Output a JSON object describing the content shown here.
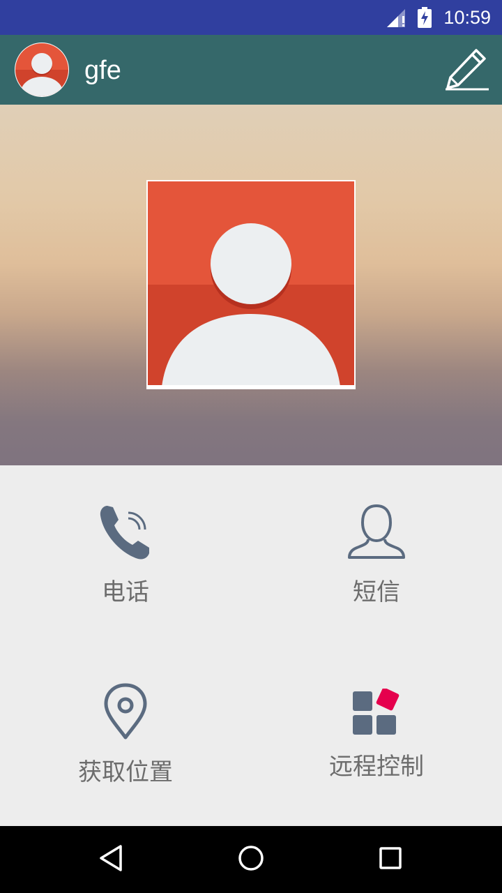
{
  "status_bar": {
    "time": "10:59",
    "icons": [
      "signal-icon",
      "battery-charging-icon"
    ]
  },
  "app_bar": {
    "title": "gfe",
    "avatar_icon": "avatar-icon",
    "edit_icon": "pencil-icon"
  },
  "hero": {
    "photo_icon": "default-avatar-icon"
  },
  "actions": [
    {
      "label": "电话",
      "icon": "phone-icon"
    },
    {
      "label": "短信",
      "icon": "person-outline-icon"
    },
    {
      "label": "获取位置",
      "icon": "location-pin-icon"
    },
    {
      "label": "远程控制",
      "icon": "apps-grid-icon"
    }
  ],
  "nav_bar": {
    "icons": [
      "back-triangle-icon",
      "home-circle-icon",
      "recents-square-icon"
    ]
  },
  "colors": {
    "status_bar": "#303f9f",
    "app_bar": "#35686a",
    "avatar_red": "#e4553a",
    "icon_slate": "#5b6b80",
    "accent_pink": "#e5004d"
  }
}
